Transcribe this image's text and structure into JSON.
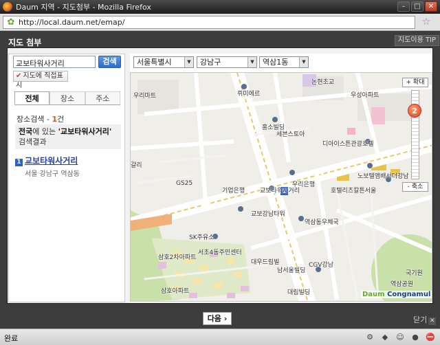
{
  "window": {
    "title": "Daum 지역 - 지도첨부 - Mozilla Firefox"
  },
  "browser": {
    "url": "http://local.daum.net/emap/"
  },
  "popup": {
    "title": "지도 첨부",
    "tip_button": "지도이용 TIP",
    "next_button": "다음 ›",
    "close_label": "닫기",
    "close_icon": "close-icon"
  },
  "search": {
    "value": "교보타워사거리",
    "button": "검색",
    "mark_button": "지도에 직접표시"
  },
  "tabs": [
    {
      "label": "전체",
      "active": true
    },
    {
      "label": "장소",
      "active": false
    },
    {
      "label": "주소",
      "active": false
    }
  ],
  "results": {
    "count_prefix": "장소검색 - ",
    "count": "1",
    "count_suffix": "건",
    "box_prefix": "전국",
    "box_mid": "에 있는 ",
    "box_query": "'교보타워사거리'",
    "box_suffix": "검색결과",
    "items": [
      {
        "marker": "1",
        "name": "교보타워사거리",
        "address": "서울 강남구 역삼동"
      }
    ]
  },
  "region": {
    "city": "서울특별시",
    "district": "강남구",
    "dong": "역삼1동"
  },
  "map": {
    "zoom_in": "+ 확대",
    "zoom_out": "- 축소",
    "zoom_level": "2",
    "brand_daum": "Daum",
    "brand_partner": "Congnamul",
    "labels": [
      "논현초교",
      "우리마트",
      "뤼미에르",
      "우성아파트",
      "홍소빌딩",
      "세븐스토아",
      "디아이스튼관광호텔",
      "노보텔앰배서더강남",
      "호텔리츠칼튼서울",
      "GS25",
      "기업은행",
      "우리은행",
      "교보타워사거리",
      "교보강남타워",
      "역삼동우체국",
      "SK주유소",
      "서초4동주민센터",
      "삼호2차아파트",
      "대우드림빌",
      "남서울빌딩",
      "CGV강남",
      "국기원",
      "역삼공원",
      "대림빌딩",
      "삼호아파트",
      "갈리"
    ]
  },
  "status": {
    "text": "완료"
  }
}
